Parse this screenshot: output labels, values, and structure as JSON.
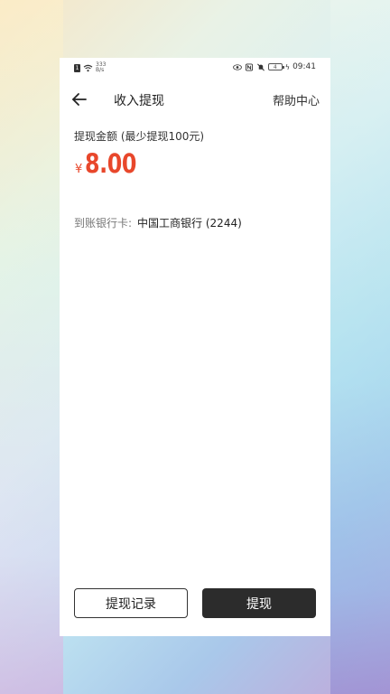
{
  "status_bar": {
    "sim_label": "1",
    "net_speed_value": "333",
    "net_speed_unit": "B/s",
    "battery_level": "4",
    "time": "09:41"
  },
  "nav": {
    "title": "收入提现",
    "help_label": "帮助中心"
  },
  "amount": {
    "label": "提现金额 (最少提现100元)",
    "currency_symbol": "¥",
    "value": "8.00"
  },
  "bank": {
    "label": "到账银行卡:",
    "value": "中国工商银行 (2244)"
  },
  "actions": {
    "record_label": "提现记录",
    "withdraw_label": "提现"
  },
  "colors": {
    "amount": "#e8472b",
    "primary_button": "#2c2c2c"
  }
}
